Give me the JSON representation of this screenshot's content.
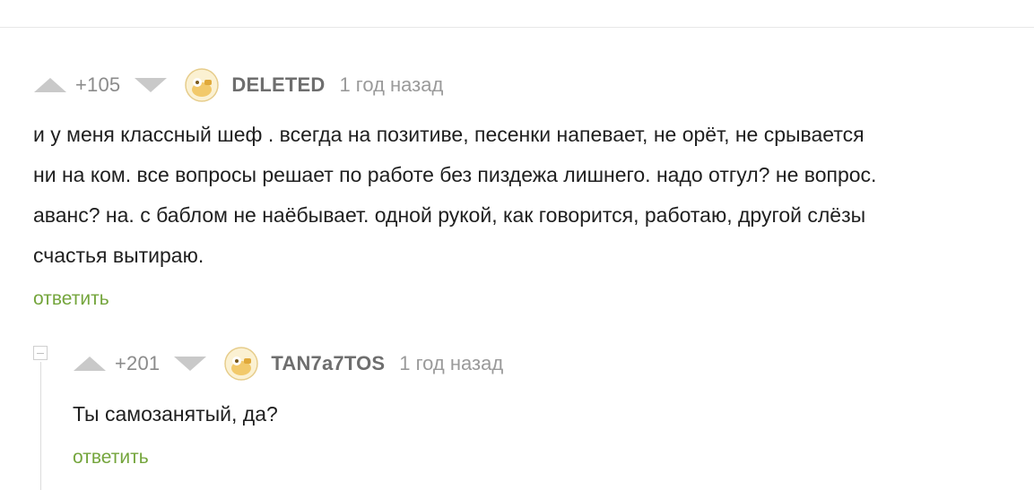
{
  "comments": [
    {
      "rating": "+105",
      "username": "DELETED",
      "timestamp": "1 год назад",
      "text_lines": [
        "и  у меня классный шеф . всегда на позитиве, песенки напевает, не орёт, не срывается",
        "ни на ком. все вопросы решает по работе без пиздежа лишнего. надо отгул? не вопрос.",
        "аванс? на. с баблом не наёбывает. одной рукой, как говорится, работаю, другой слёзы",
        "счастья вытираю."
      ],
      "reply_label": "ответить",
      "avatar_icon": "default-avatar-icon",
      "upvote_icon": "upvote-icon",
      "downvote_icon": "downvote-icon"
    },
    {
      "rating": "+201",
      "username": "TAN7a7TOS",
      "timestamp": "1 год назад",
      "text_lines": [
        "Ты самозанятый, да?"
      ],
      "reply_label": "ответить",
      "avatar_icon": "default-avatar-icon",
      "upvote_icon": "upvote-icon",
      "downvote_icon": "downvote-icon",
      "collapse_icon": "collapse-icon"
    }
  ],
  "colors": {
    "reply_link": "#74a53c",
    "vote_arrow": "#c9c9c9",
    "meta_text": "#9a9a9a",
    "username": "#6e6e6e",
    "body_text": "#1f1f1f"
  }
}
